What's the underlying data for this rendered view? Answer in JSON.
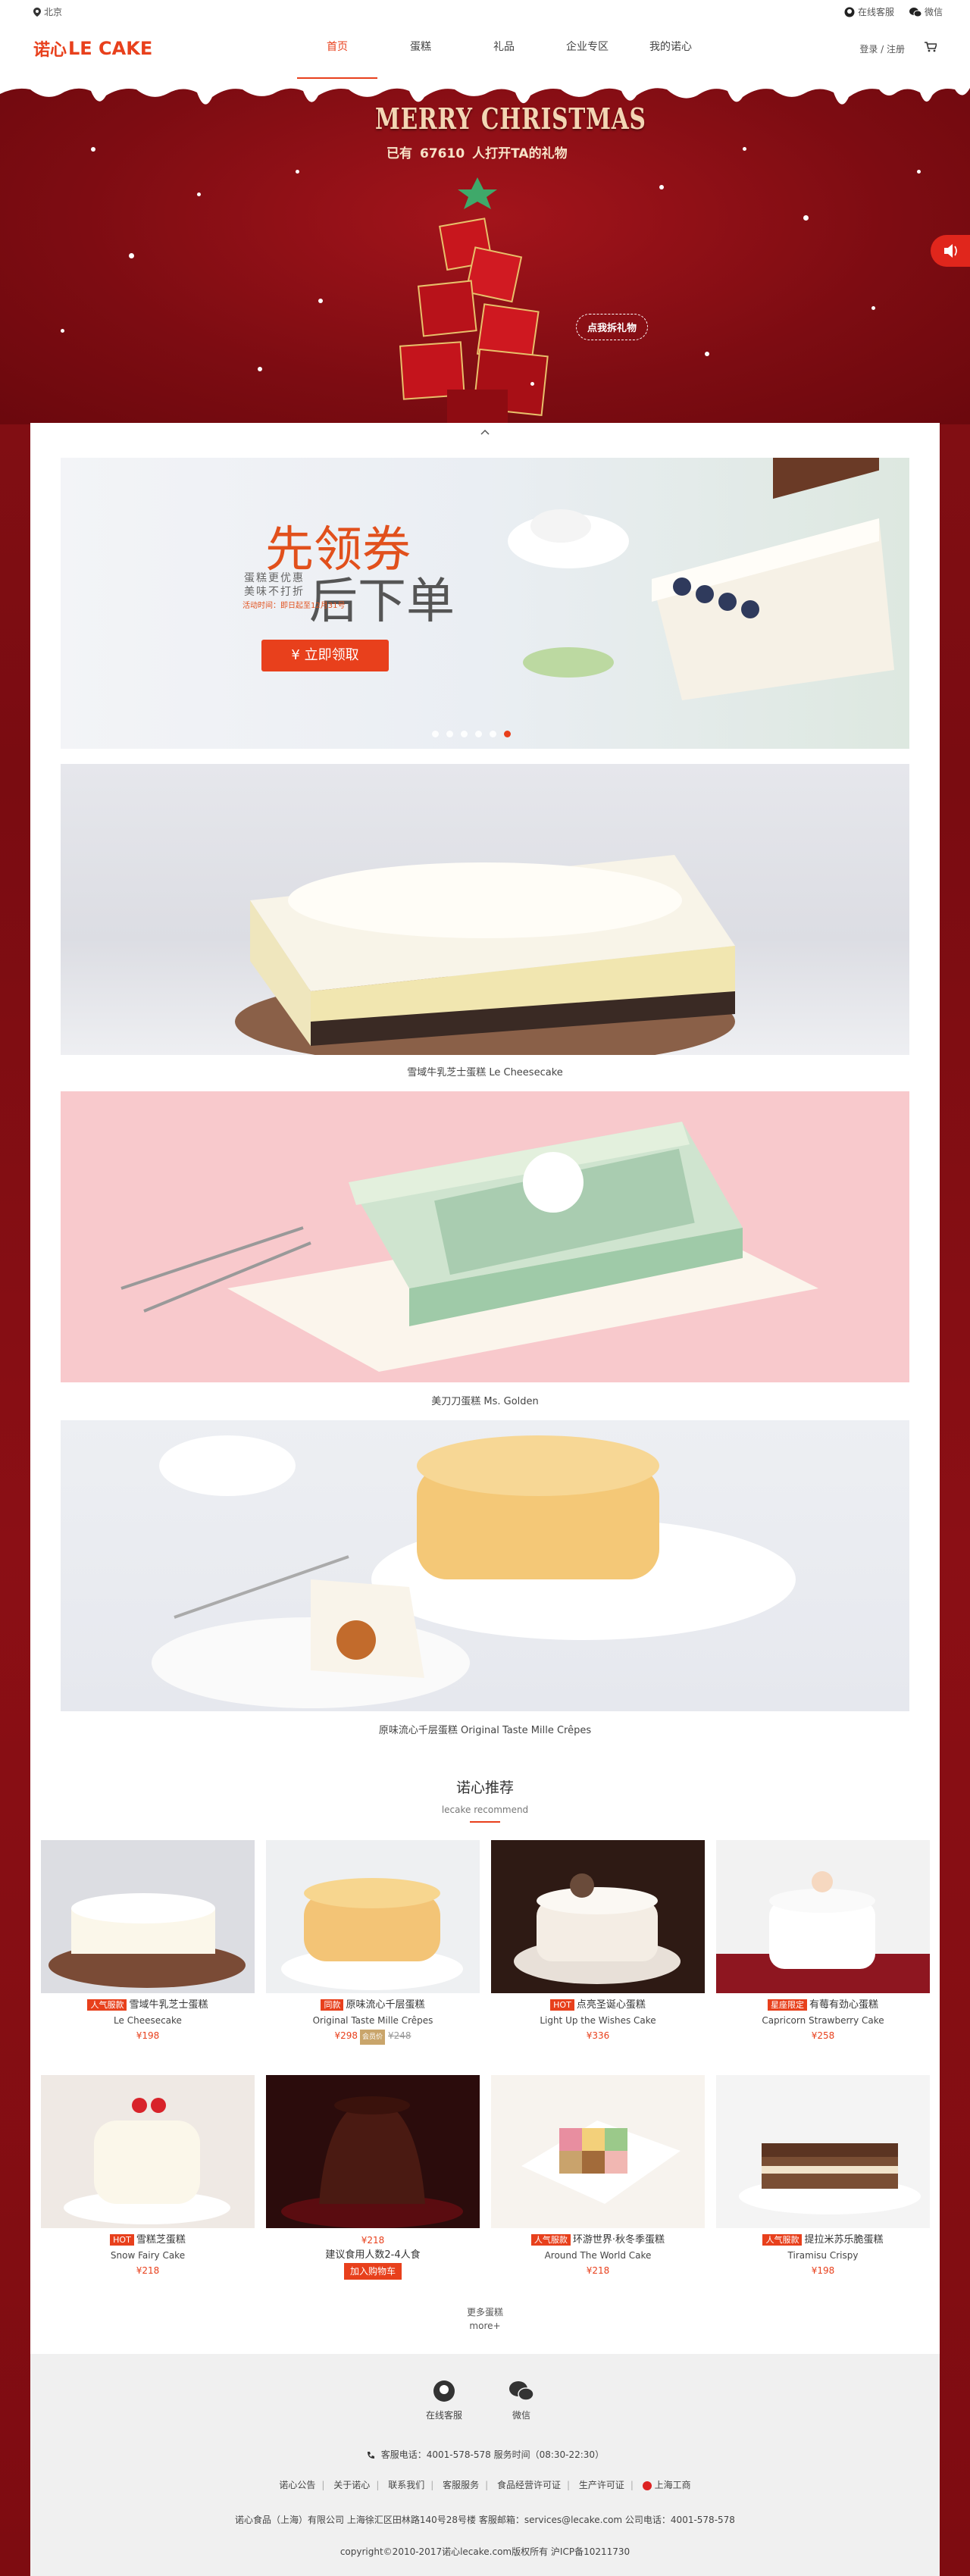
{
  "topbar": {
    "location": "北京",
    "service": "在线客服",
    "wechat": "微信"
  },
  "header": {
    "logo_cn": "诺心",
    "logo_en": "LE CAKE",
    "nav": [
      "首页",
      "蛋糕",
      "礼品",
      "企业专区",
      "我的诺心"
    ],
    "login": "登录 / 注册"
  },
  "hero": {
    "title": "MERRY CHRISTMAS",
    "sub_prefix": "已有",
    "count": "67610",
    "sub_suffix": "人打开TA的礼物",
    "gift_button": "点我拆礼物"
  },
  "banners": {
    "coupon_title1": "先领券",
    "coupon_title2": "后下单",
    "coupon_slogan": "蛋糕更优惠 美味不打折",
    "coupon_date": "活动时间：即日起至12月31号",
    "coupon_button": "¥ 立即领取",
    "captions": [
      "雪域牛乳芝士蛋糕 Le Cheesecake",
      "美刀刀蛋糕 Ms. Golden",
      "原味流心千层蛋糕 Original Taste Mille Crêpes"
    ]
  },
  "recommend": {
    "title": "诺心推荐",
    "subtitle": "lecake recommend",
    "products": [
      {
        "tag": "人气服款",
        "name": "雪域牛乳芝士蛋糕",
        "en": "Le Cheesecake",
        "price": "¥198"
      },
      {
        "tag": "同款",
        "name": "原味流心千层蛋糕",
        "en": "Original Taste Mille Crêpes",
        "price": "¥298",
        "old_price": "¥248",
        "vip": "会员价"
      },
      {
        "tag": "HOT",
        "name": "点亮圣诞心蛋糕",
        "en": "Light Up the Wishes Cake",
        "price": "¥336"
      },
      {
        "tag": "星座限定",
        "name": "有莓有劲心蛋糕",
        "en": "Capricorn Strawberry Cake",
        "price": "¥258"
      },
      {
        "tag": "HOT",
        "name": "雪糕芝蛋糕",
        "en": "Snow Fairy Cake",
        "price": "¥218"
      },
      {
        "price": "¥218",
        "desc": "建议食用人数2-4人食",
        "button": "加入购物车"
      },
      {
        "tag": "人气服款",
        "name": "环游世界·秋冬季蛋糕",
        "en": "Around The World Cake",
        "price": "¥218"
      },
      {
        "tag": "人气服款",
        "name": "提拉米苏乐脆蛋糕",
        "en": "Tiramisu Crispy",
        "price": "¥198"
      }
    ],
    "more_cn": "更多蛋糕",
    "more_en": "more+"
  },
  "footer": {
    "service_label": "在线客服",
    "wechat_label": "微信",
    "hotline": "客服电话：4001-578-578 服务时间（08:30-22:30）",
    "links": [
      "诺心公告",
      "关于诺心",
      "联系我们",
      "客服服务",
      "食品经营许可证",
      "生产许可证",
      "上海工商"
    ],
    "company": "诺心食品（上海）有限公司 上海徐汇区田林路140号28号楼 客服邮箱：services@lecake.com 公司电话：4001-578-578",
    "copyright": "copyright©2010-2017诺心lecake.com版权所有 沪ICP备10211730"
  },
  "colors": {
    "accent": "#e8401c",
    "hero_red": "#8a1016"
  }
}
